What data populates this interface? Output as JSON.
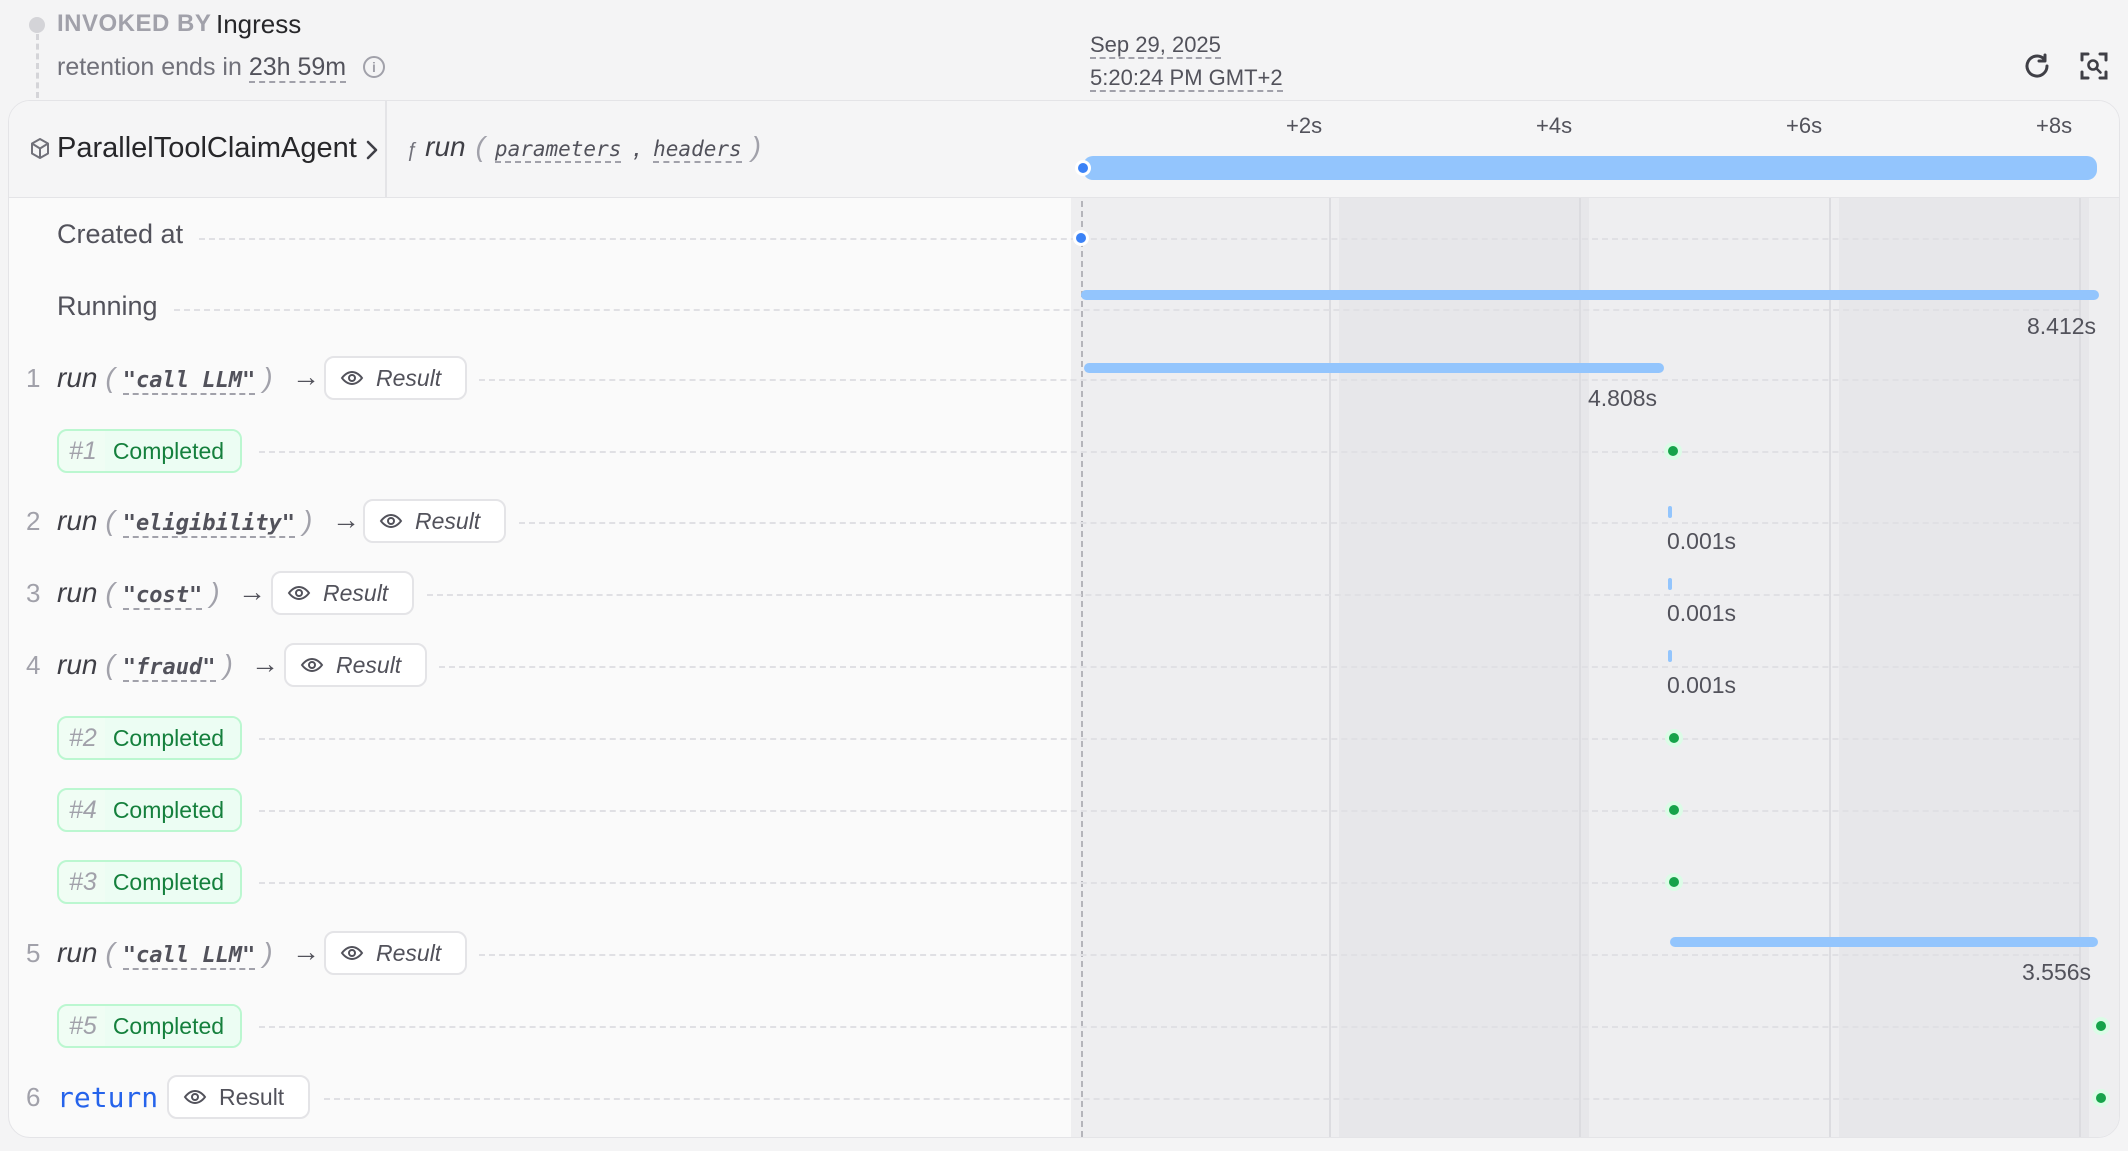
{
  "invocation": {
    "invoked_by_label": "INVOKED BY",
    "invoked_by_value": "Ingress",
    "retention_prefix": "retention ends in",
    "retention_value": "23h 59m"
  },
  "timestamp": {
    "date": "Sep 29, 2025",
    "time": "5:20:24 PM GMT+2"
  },
  "toolbar": {
    "refresh_icon": "refresh-icon",
    "focus_icon": "zoom-focus-icon"
  },
  "header": {
    "agent_icon": "cube-icon",
    "agent_name": "ParallelToolClaimAgent",
    "function_glyph": "ƒ",
    "function_name": "run",
    "params": [
      "parameters",
      "headers"
    ],
    "ticks": [
      "+2s",
      "+4s",
      "+6s",
      "+8s"
    ]
  },
  "rows": {
    "created_at": {
      "label": "Created at"
    },
    "running": {
      "label": "Running",
      "duration": "8.412s"
    },
    "calls": [
      {
        "num": "1",
        "fn": "run",
        "arg": "\"call LLM\"",
        "result": "Result",
        "duration": "4.808s"
      },
      {
        "num": "2",
        "fn": "run",
        "arg": "\"eligibility\"",
        "result": "Result",
        "duration": "0.001s"
      },
      {
        "num": "3",
        "fn": "run",
        "arg": "\"cost\"",
        "result": "Result",
        "duration": "0.001s"
      },
      {
        "num": "4",
        "fn": "run",
        "arg": "\"fraud\"",
        "result": "Result",
        "duration": "0.001s"
      },
      {
        "num": "5",
        "fn": "run",
        "arg": "\"call LLM\"",
        "result": "Result",
        "duration": "3.556s"
      }
    ],
    "completions": [
      {
        "id": "#1",
        "status": "Completed"
      },
      {
        "id": "#2",
        "status": "Completed"
      },
      {
        "id": "#4",
        "status": "Completed"
      },
      {
        "id": "#3",
        "status": "Completed"
      },
      {
        "id": "#5",
        "status": "Completed"
      }
    ],
    "return": {
      "num": "6",
      "keyword": "return",
      "result": "Result"
    }
  },
  "colors": {
    "bar": "#93c5fd",
    "accent_blue": "#3b82f6",
    "completed_green": "#16a34a"
  }
}
